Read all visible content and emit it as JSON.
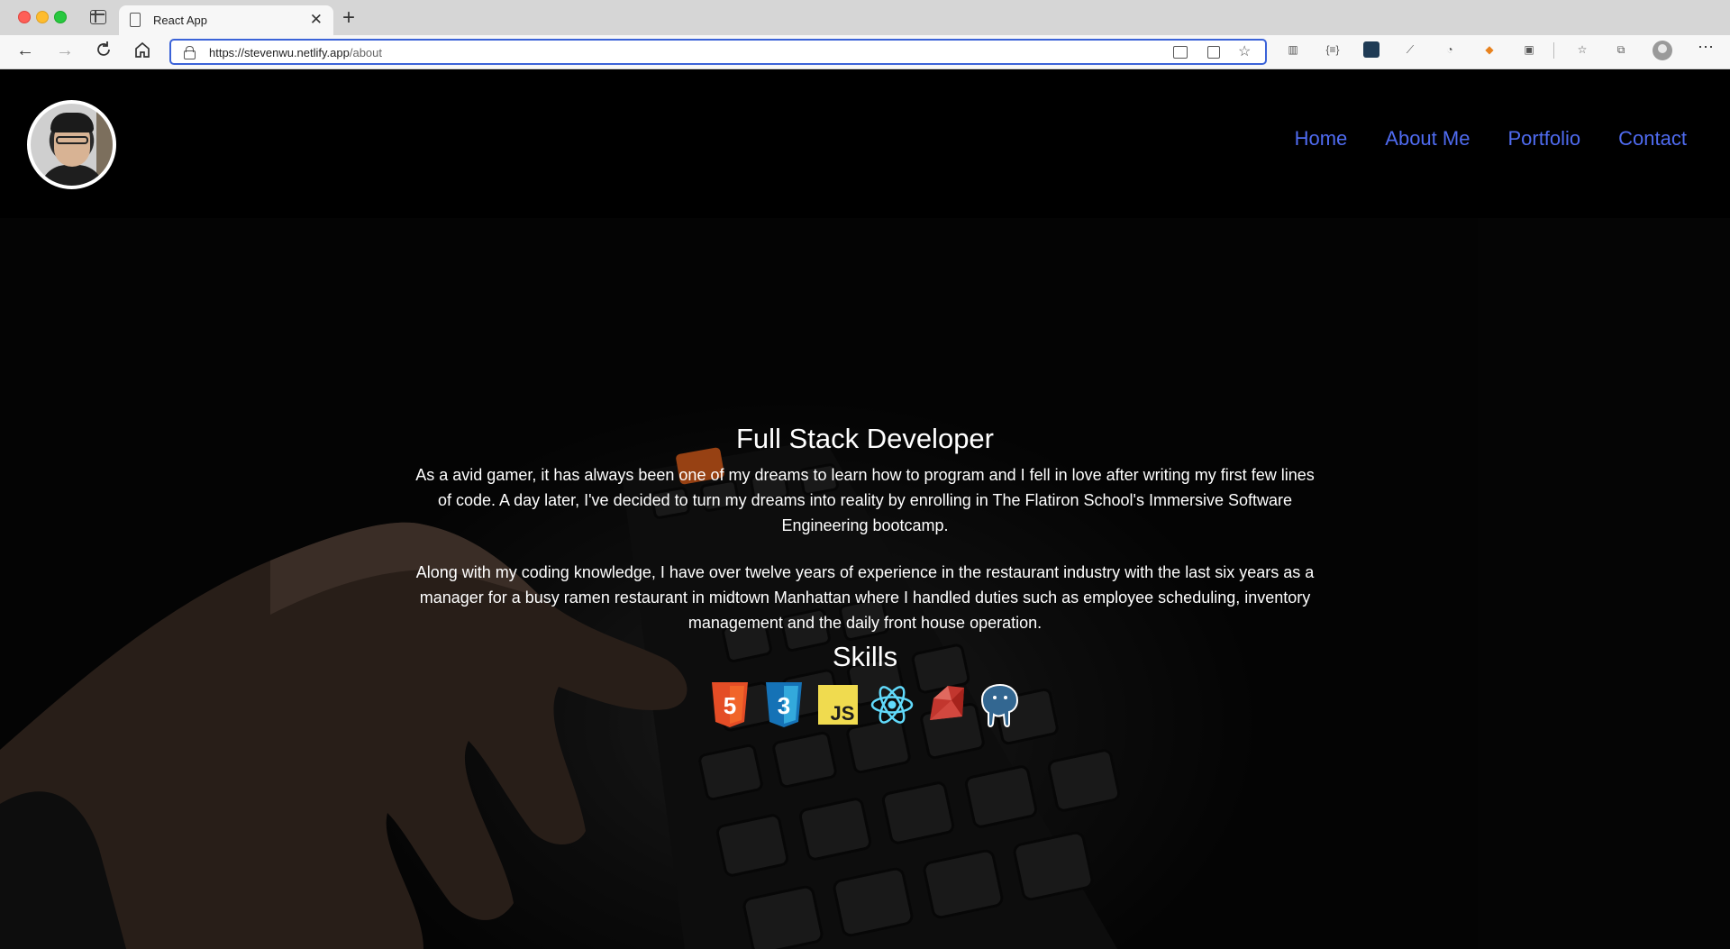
{
  "browser": {
    "tab_title": "React App",
    "url_domain": "https://stevenwu.netlify.app",
    "url_path": "/about"
  },
  "site": {
    "nav": [
      "Home",
      "About Me",
      "Portfolio",
      "Contact"
    ]
  },
  "about": {
    "title": "Full Stack Developer",
    "paragraph_1": "As a avid gamer, it has always been one of my dreams to learn how to program and I fell in love after writing my first few lines of code. A day later, I've decided to turn my dreams into reality by enrolling in The Flatiron School's Immersive Software Engineering bootcamp.",
    "paragraph_2": "Along with my coding knowledge, I have over twelve years of experience in the restaurant industry with the last six years as a manager for a busy ramen restaurant in midtown Manhattan where I handled duties such as employee scheduling, inventory management and the daily front house operation.",
    "skills_title": "Skills",
    "skill_icon_labels": {
      "html5": "5",
      "css3": "3",
      "javascript": "JS"
    },
    "skills": [
      "html5-icon",
      "css3-icon",
      "javascript-icon",
      "react-icon",
      "ruby-icon",
      "postgresql-icon"
    ]
  },
  "colors": {
    "nav_link": "#4f6bf0",
    "page_background": "#000000",
    "url_focus_border": "#3b63d8"
  }
}
